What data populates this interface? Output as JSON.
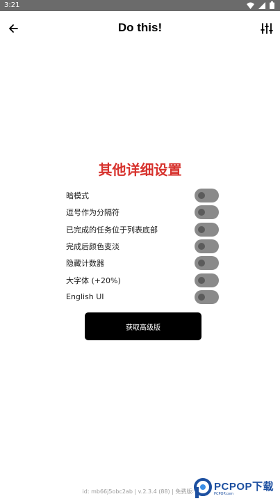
{
  "status_bar": {
    "time": "3:21"
  },
  "app_bar": {
    "title": "Do this!"
  },
  "section": {
    "title": "其他详细设置"
  },
  "settings": [
    {
      "label": "暗模式",
      "enabled": false
    },
    {
      "label": "逗号作为分隔符",
      "enabled": false
    },
    {
      "label": "已完成的任务位于列表底部",
      "enabled": false
    },
    {
      "label": "完成后颜色变淡",
      "enabled": false
    },
    {
      "label": "隐藏计数器",
      "enabled": false
    },
    {
      "label": "大字体 (+20%)",
      "enabled": false
    },
    {
      "label": "English UI",
      "enabled": false
    }
  ],
  "premium_button": {
    "label": "获取高级版"
  },
  "footer": {
    "text": "id: mb66j5obc2ab | v.2.3.4 (88) | 免费版本"
  },
  "watermark": {
    "main": "PCPOP下载",
    "sub": "PCPOP.com"
  },
  "colors": {
    "accent": "#d7322d",
    "toggle_track": "#8a8a8a",
    "button_bg": "#000000"
  }
}
